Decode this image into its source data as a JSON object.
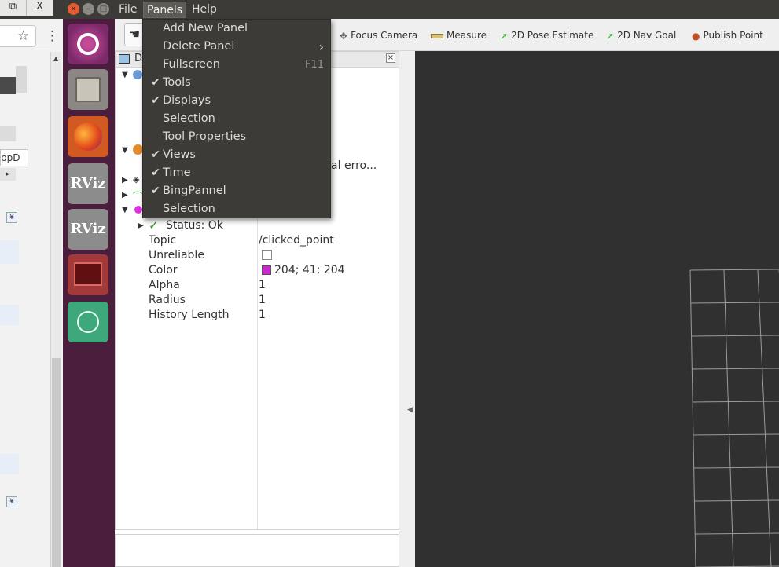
{
  "window": {
    "menus": [
      "File",
      "Panels",
      "Help"
    ],
    "restore_glyph": "⧉",
    "close_glyph": "X",
    "tb_close_glyph": "×",
    "tb_min_glyph": "–",
    "tb_max_glyph": "□"
  },
  "panels_menu": {
    "items": [
      {
        "label": "Add New Panel",
        "checked": false
      },
      {
        "label": "Delete Panel",
        "checked": false,
        "submenu": true
      },
      {
        "label": "Fullscreen",
        "checked": false,
        "shortcut": "F11"
      },
      {
        "label": "Tools",
        "checked": true
      },
      {
        "label": "Displays",
        "checked": true
      },
      {
        "label": "Selection",
        "checked": false
      },
      {
        "label": "Tool Properties",
        "checked": false
      },
      {
        "label": "Views",
        "checked": true
      },
      {
        "label": "Time",
        "checked": true
      },
      {
        "label": "BingPannel",
        "checked": true
      },
      {
        "label": "Selection",
        "checked": false
      }
    ],
    "check_glyph": "✔",
    "submenu_glyph": "›"
  },
  "toolbar": {
    "focus_camera": "Focus Camera",
    "measure": "Measure",
    "pose_estimate": "2D Pose Estimate",
    "nav_goal": "2D Nav Goal",
    "publish_point": "Publish Point"
  },
  "displays": {
    "header_fragment": "D",
    "error_fragment": "ctual erro...",
    "status": "Status: Ok",
    "properties": [
      {
        "key": "Topic",
        "value": "/clicked_point"
      },
      {
        "key": "Unreliable",
        "value": ""
      },
      {
        "key": "Color",
        "value": "204; 41; 204"
      },
      {
        "key": "Alpha",
        "value": "1"
      },
      {
        "key": "Radius",
        "value": "1"
      },
      {
        "key": "History Length",
        "value": "1"
      }
    ],
    "point_color": "#cc29cc"
  },
  "browser": {
    "fragment_text": "ppD",
    "star_glyph": "☆",
    "kebab_glyph": "⋮"
  },
  "colors": {
    "ubuntu_topbar": "#3c3b37",
    "launcher": "#4b1e3e",
    "viewport": "#303030",
    "grid": "#9a9a9a"
  }
}
